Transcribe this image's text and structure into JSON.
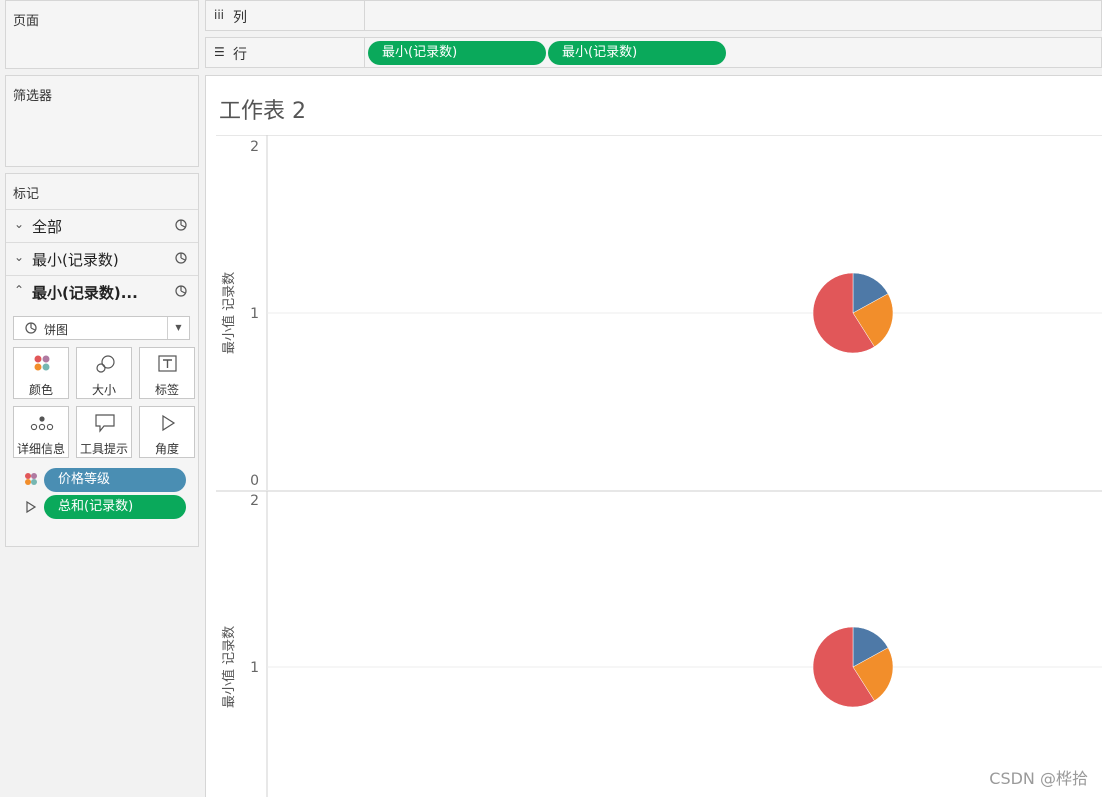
{
  "left_panel": {
    "pages_title": "页面",
    "filters_title": "筛选器",
    "marks": {
      "title": "标记",
      "rows": [
        {
          "label": "全部",
          "chevron": "⌄",
          "bold": false
        },
        {
          "label": "最小(记录数)",
          "chevron": "⌄",
          "bold": false
        },
        {
          "label": "最小(记录数)...",
          "chevron": "⌃",
          "bold": true
        }
      ],
      "mark_type": "饼图",
      "tiles": [
        {
          "label": "颜色",
          "icon": "color-icon"
        },
        {
          "label": "大小",
          "icon": "size-icon"
        },
        {
          "label": "标签",
          "icon": "label-icon"
        },
        {
          "label": "详细信息",
          "icon": "detail-icon"
        },
        {
          "label": "工具提示",
          "icon": "tooltip-icon"
        },
        {
          "label": "角度",
          "icon": "angle-icon"
        }
      ],
      "fields": [
        {
          "label": "价格等级",
          "encoding": "color-icon",
          "color": "#4a8eb3"
        },
        {
          "label": "总和(记录数)",
          "encoding": "angle-icon",
          "color": "#0aa95b"
        }
      ]
    }
  },
  "shelves": {
    "columns": {
      "icon": "iii",
      "label": "列"
    },
    "rows": {
      "icon": "☰",
      "label": "行",
      "pills": [
        "最小(记录数)",
        "最小(记录数)"
      ],
      "pill_color": "#0aa95b"
    }
  },
  "sheet_title": "工作表 2",
  "watermark": "CSDN @桦拾",
  "colors": {
    "pill_green": "#0aa95b",
    "pill_blue": "#4a8eb3",
    "pie_blue": "#4e79a7",
    "pie_orange": "#f28e2b",
    "pie_red": "#e15759"
  },
  "chart_data": [
    {
      "type": "pie",
      "ylabel": "最小值 记录数",
      "ylim": [
        0,
        2
      ],
      "y_ticks": [
        "2",
        "1",
        "0"
      ],
      "y": 1,
      "slices": [
        {
          "value": 17,
          "color": "#4e79a7"
        },
        {
          "value": 24,
          "color": "#f28e2b"
        },
        {
          "value": 59,
          "color": "#e15759"
        }
      ]
    },
    {
      "type": "pie",
      "ylabel": "最小值 记录数",
      "ylim": [
        0,
        2
      ],
      "y_ticks": [
        "2",
        "1"
      ],
      "y": 1,
      "slices": [
        {
          "value": 17,
          "color": "#4e79a7"
        },
        {
          "value": 24,
          "color": "#f28e2b"
        },
        {
          "value": 59,
          "color": "#e15759"
        }
      ]
    }
  ]
}
